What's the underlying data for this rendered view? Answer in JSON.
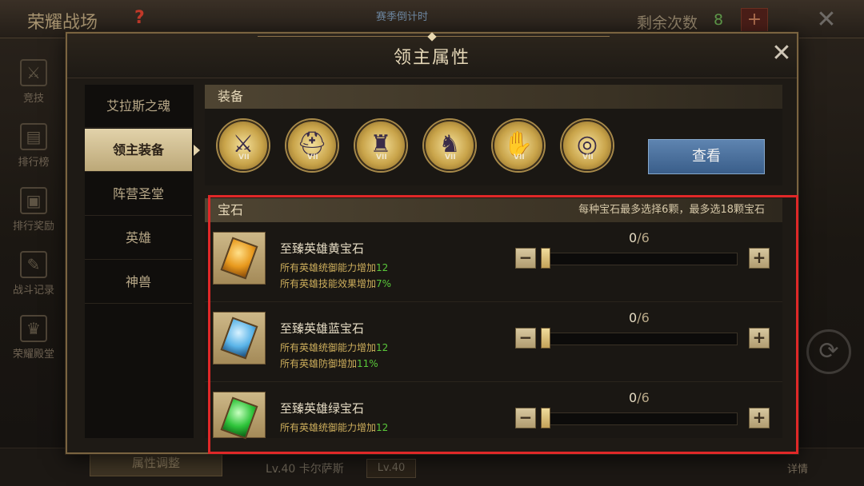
{
  "background": {
    "title": "荣耀战场",
    "help_symbol": "?",
    "countdown_label": "赛季倒计时",
    "remaining_label": "剩余次数",
    "remaining_count": "8",
    "plus_symbol": "+",
    "close_symbol": "✕",
    "sidebar": [
      {
        "label": "竞技",
        "icon": "swords-icon",
        "glyph": "⚔"
      },
      {
        "label": "排行榜",
        "icon": "ranking-icon",
        "glyph": "▤"
      },
      {
        "label": "排行奖励",
        "icon": "reward-icon",
        "glyph": "▣"
      },
      {
        "label": "战斗记录",
        "icon": "record-icon",
        "glyph": "✎"
      },
      {
        "label": "荣耀殿堂",
        "icon": "hall-icon",
        "glyph": "♛"
      }
    ],
    "attr_adjust_label": "属性调整",
    "hero_level_name": "Lv.40 卡尔萨斯",
    "hero_level_badge": "Lv.40",
    "detail_label": "详情",
    "refresh_symbol": "⟳"
  },
  "modal": {
    "title": "领主属性",
    "close_symbol": "✕",
    "tabs": [
      {
        "label": "艾拉斯之魂",
        "active": false
      },
      {
        "label": "领主装备",
        "active": true
      },
      {
        "label": "阵营圣堂",
        "active": false
      },
      {
        "label": "英雄",
        "active": false
      },
      {
        "label": "神兽",
        "active": false
      }
    ],
    "equipment": {
      "section_label": "装备",
      "slots": [
        {
          "icon": "sword-icon",
          "glyph": "⚔",
          "rank": "VII"
        },
        {
          "icon": "helmet-icon",
          "glyph": "⛑",
          "rank": "VII"
        },
        {
          "icon": "armor-icon",
          "glyph": "♜",
          "rank": "VII"
        },
        {
          "icon": "boots-icon",
          "glyph": "♞",
          "rank": "VII"
        },
        {
          "icon": "gauntlet-icon",
          "glyph": "✋",
          "rank": "VII"
        },
        {
          "icon": "ring-icon",
          "glyph": "◎",
          "rank": "VII"
        }
      ],
      "view_button": "查看"
    },
    "gems": {
      "section_label": "宝石",
      "note": "每种宝石最多选择6颗，最多选18颗宝石",
      "minus_symbol": "−",
      "plus_symbol": "+",
      "items": [
        {
          "name": "至臻英雄黄宝石",
          "color": "#e89a1e",
          "effects": [
            {
              "text": "所有英雄统御能力增加",
              "value": "12"
            },
            {
              "text": "所有英雄技能效果增加",
              "value": "7%"
            }
          ],
          "count": "0",
          "max": "/6",
          "level": 0
        },
        {
          "name": "至臻英雄蓝宝石",
          "color": "#5ab4e8",
          "effects": [
            {
              "text": "所有英雄统御能力增加",
              "value": "12"
            },
            {
              "text": "所有英雄防御增加",
              "value": "11%"
            }
          ],
          "count": "0",
          "max": "/6",
          "level": 0
        },
        {
          "name": "至臻英雄绿宝石",
          "color": "#2ec43a",
          "effects": [
            {
              "text": "所有英雄统御能力增加",
              "value": "12"
            }
          ],
          "count": "0",
          "max": "/6",
          "level": 0
        }
      ]
    }
  },
  "highlight_color": "#e02828"
}
